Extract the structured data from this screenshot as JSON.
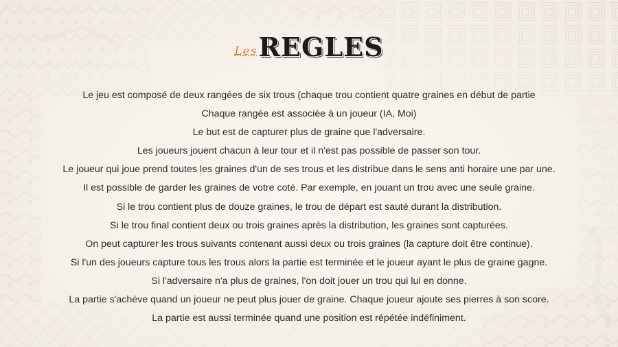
{
  "title": {
    "prefix": "Les",
    "main": "REGLES"
  },
  "rules": [
    "Le jeu est composé de deux rangées de six trous (chaque trou contient quatre graines en début de partie",
    "Chaque rangée est associée à un joueur (IA, Moi)",
    "Le but est de capturer plus de graine que l'adversaire.",
    "Les joueurs jouent chacun à leur tour et il n'est pas possible de passer son tour.",
    "Le joueur qui joue prend toutes les graines d'un de ses trous et les distribue dans le sens anti horaire une par une.",
    "Il est possible de garder les graines de votre coté. Par exemple, en jouant un trou avec une seule graine.",
    "Si le trou contient plus de douze graines, le trou de départ est sauté durant la distribution.",
    "Si le trou final contient deux ou trois graines après la distribution, les graines sont capturées.",
    "On peut capturer les trous suivants contenant aussi deux ou trois graines (la capture doit être continue).",
    "Si l'un des joueurs capture tous les trous alors la partie est terminée et le joueur ayant le plus de graine gagne.",
    "Si l'adversaire n'a plus de graines, l'on doit jouer un trou qui lui en donne.",
    "La partie s'achève quand un joueur ne peut plus jouer de graine. Chaque joueur ajoute ses pierres à son score.",
    "La partie est aussi terminée quand une position est répétée indéfiniment."
  ],
  "colors": {
    "accent": "#e87a2c",
    "text": "#2b2b2b",
    "background": "#f3efe9"
  }
}
